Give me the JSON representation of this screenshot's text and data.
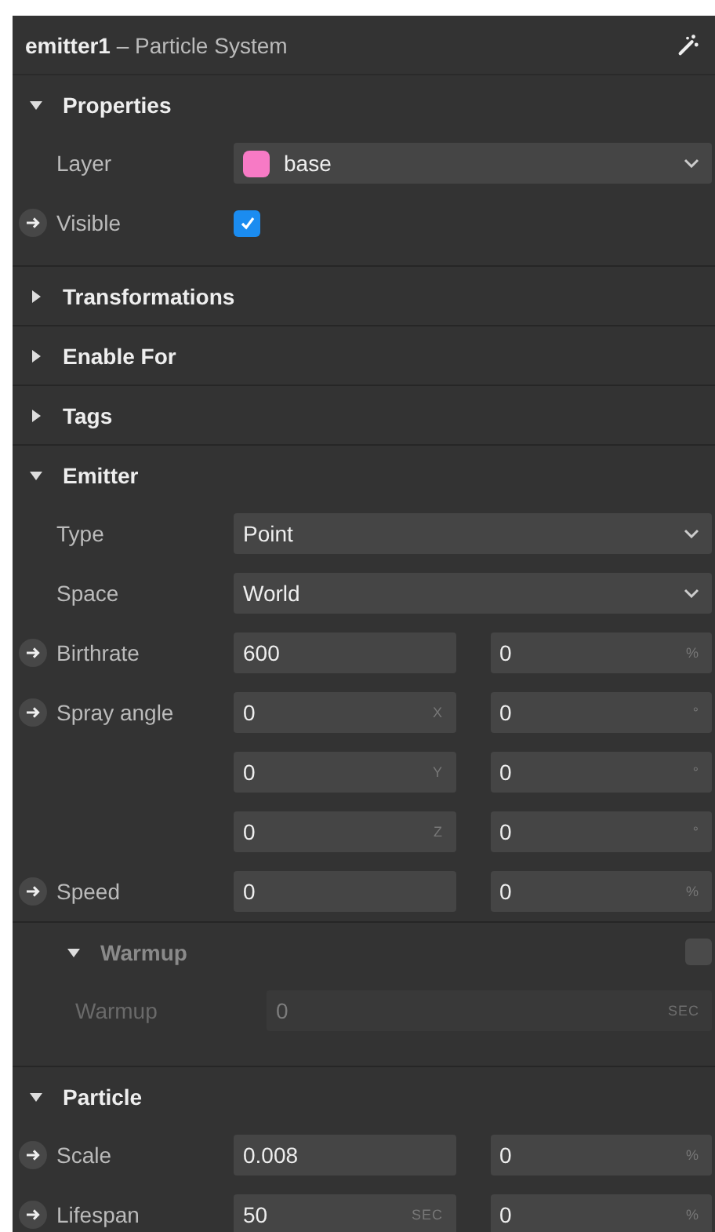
{
  "header": {
    "name": "emitter1",
    "subtitle": "– Particle System"
  },
  "sections": [
    {
      "title": "Properties",
      "expanded": true,
      "rows": [
        {
          "kind": "dropdown",
          "label": "Layer",
          "linked": false,
          "value": "base",
          "color": "#f77ac5"
        },
        {
          "kind": "checkbox",
          "label": "Visible",
          "linked": true,
          "checked": true
        }
      ]
    },
    {
      "title": "Transformations",
      "expanded": false
    },
    {
      "title": "Enable For",
      "expanded": false
    },
    {
      "title": "Tags",
      "expanded": false
    },
    {
      "title": "Emitter",
      "expanded": true,
      "rows": [
        {
          "kind": "dropdown",
          "label": "Type",
          "linked": false,
          "value": "Point"
        },
        {
          "kind": "dropdown",
          "label": "Space",
          "linked": false,
          "value": "World"
        },
        {
          "kind": "pair",
          "label": "Birthrate",
          "linked": true,
          "fields": [
            {
              "value": "600"
            },
            {
              "value": "0",
              "unit": "%"
            }
          ]
        },
        {
          "kind": "pair",
          "label": "Spray angle",
          "linked": true,
          "fields": [
            {
              "value": "0",
              "unit": "X"
            },
            {
              "value": "0",
              "unit": "°"
            }
          ]
        },
        {
          "kind": "pair",
          "linked": false,
          "fields": [
            {
              "value": "0",
              "unit": "Y"
            },
            {
              "value": "0",
              "unit": "°"
            }
          ]
        },
        {
          "kind": "pair",
          "linked": false,
          "fields": [
            {
              "value": "0",
              "unit": "Z"
            },
            {
              "value": "0",
              "unit": "°"
            }
          ]
        },
        {
          "kind": "pair",
          "label": "Speed",
          "linked": true,
          "fields": [
            {
              "value": "0"
            },
            {
              "value": "0",
              "unit": "%"
            }
          ]
        },
        {
          "kind": "group",
          "title": "Warmup",
          "expanded": true,
          "checked": false,
          "disabled": true,
          "rows": [
            {
              "kind": "single",
              "label": "Warmup",
              "value": "0",
              "unit": "SEC"
            }
          ]
        }
      ]
    },
    {
      "title": "Particle",
      "expanded": true,
      "rows": [
        {
          "kind": "pair",
          "label": "Scale",
          "linked": true,
          "fields": [
            {
              "value": "0.008"
            },
            {
              "value": "0",
              "unit": "%"
            }
          ]
        },
        {
          "kind": "pair",
          "label": "Lifespan",
          "linked": true,
          "fields": [
            {
              "value": "50",
              "unit": "SEC"
            },
            {
              "value": "0",
              "unit": "%"
            }
          ]
        }
      ]
    }
  ]
}
